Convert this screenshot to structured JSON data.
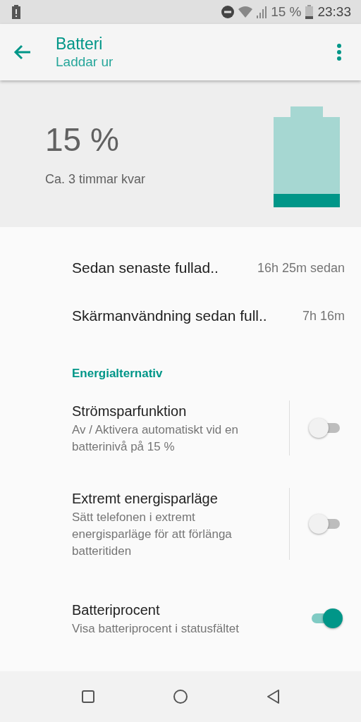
{
  "status_bar": {
    "battery_percent": "15 %",
    "time": "23:33"
  },
  "toolbar": {
    "title": "Batteri",
    "subtitle": "Laddar ur"
  },
  "summary": {
    "percent": "15 %",
    "remaining": "Ca. 3 timmar kvar"
  },
  "stats": [
    {
      "label": "Sedan senaste fullad..",
      "value": "16h 25m sedan"
    },
    {
      "label": "Skärmanvändning sedan full..",
      "value": "7h 16m"
    }
  ],
  "section": {
    "title": "Energialternativ"
  },
  "options": [
    {
      "title": "Strömsparfunktion",
      "summary": "Av / Aktivera automatiskt vid en batterinivå på 15 %",
      "divider": true,
      "on": false
    },
    {
      "title": "Extremt energisparläge",
      "summary": "Sätt telefonen i extremt energisparläge för att förlänga batteritiden",
      "divider": true,
      "on": false
    },
    {
      "title": "Batteriprocent",
      "summary": "Visa batteriprocent i statusfältet",
      "divider": false,
      "on": true
    }
  ]
}
